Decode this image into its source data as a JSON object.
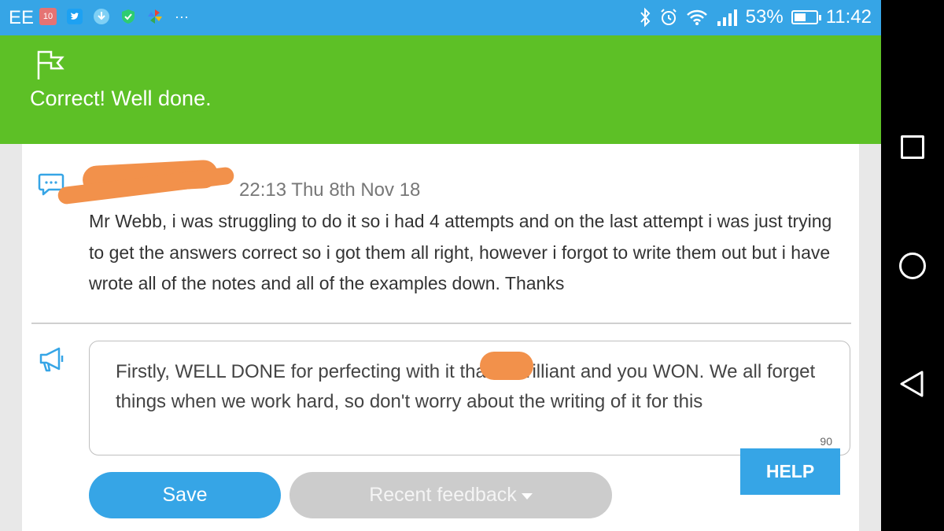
{
  "status_bar": {
    "carrier": "EE",
    "calendar_date": "10",
    "overflow": "···",
    "battery": "53%",
    "battery_fraction": 0.53,
    "time": "11:42"
  },
  "banner": {
    "message": "Correct! Well done."
  },
  "comment": {
    "timestamp": "22:13 Thu 8th Nov 18",
    "body": "Mr Webb, i was struggling to do it so i had 4 attempts and on the last attempt i was just trying to get the answers correct so i got them all right, however i forgot to write them out but i have wrote all of the notes and all of the examples down. Thanks"
  },
  "feedback": {
    "text": "Firstly, WELL DONE for perfecting with it         that is brilliant and you WON. We all forget things when we work hard, so don't worry about the writing of it for this",
    "char_count": "90"
  },
  "buttons": {
    "help": "HELP",
    "save": "Save",
    "recent_feedback": "Recent feedback"
  },
  "colors": {
    "status_blue": "#36a5e6",
    "banner_green": "#5dc026",
    "redaction_orange": "#f2914b"
  }
}
